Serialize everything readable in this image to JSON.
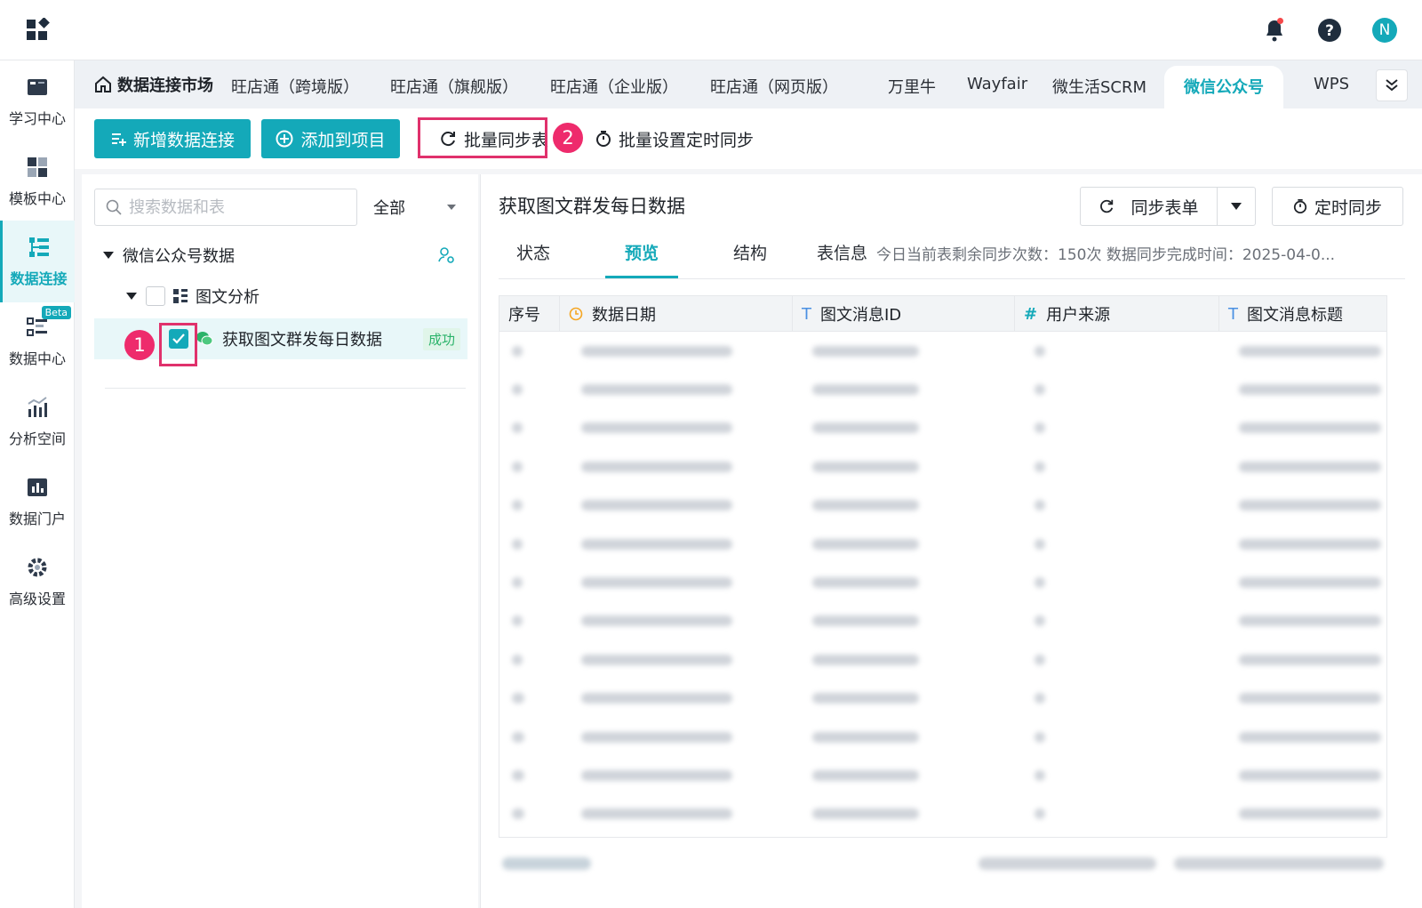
{
  "topbar": {
    "avatar_letter": "N"
  },
  "nav": {
    "items": [
      {
        "label": "学习中心",
        "icon": "book-icon"
      },
      {
        "label": "模板中心",
        "icon": "template-icon"
      },
      {
        "label": "数据连接",
        "icon": "data-connect-icon",
        "active": true
      },
      {
        "label": "数据中心",
        "icon": "data-center-icon",
        "badge": "Beta"
      },
      {
        "label": "分析空间",
        "icon": "analysis-icon"
      },
      {
        "label": "数据门户",
        "icon": "portal-icon"
      },
      {
        "label": "高级设置",
        "icon": "gear-icon"
      }
    ]
  },
  "tabs": {
    "home": "数据连接市场",
    "items": [
      "旺店通（跨境版）",
      "旺店通（旗舰版）",
      "旺店通（企业版）",
      "旺店通（网页版）",
      "万里牛",
      "Wayfair",
      "微生活SCRM",
      "微信公众号",
      "WPS"
    ],
    "active": "微信公众号"
  },
  "toolbar": {
    "add_connection": "新增数据连接",
    "add_to_project": "添加到项目",
    "batch_sync": "批量同步表",
    "batch_timer": "批量设置定时同步",
    "step1": "1",
    "step2": "2"
  },
  "leftpanel": {
    "search_placeholder": "搜索数据和表",
    "filter": "全部",
    "root": "微信公众号数据",
    "group": "图文分析",
    "table": "获取图文群发每日数据",
    "table_status": "成功"
  },
  "rightpanel": {
    "title": "获取图文群发每日数据",
    "sync_button": "同步表单",
    "timer_button": "定时同步",
    "subtabs": [
      "状态",
      "预览",
      "结构",
      "表信息"
    ],
    "active_subtab": "预览",
    "info": "今日当前表剩余同步次数：150次   数据同步完成时间：2025-04-0...",
    "columns": [
      {
        "label": "序号",
        "icon": ""
      },
      {
        "label": "数据日期",
        "icon": "clock-icon"
      },
      {
        "label": "图文消息ID",
        "icon": "text-type-icon"
      },
      {
        "label": "用户来源",
        "icon": "number-type-icon"
      },
      {
        "label": "图文消息标题",
        "icon": "text-type-icon"
      }
    ]
  },
  "colors": {
    "accent": "#14a9b9",
    "highlight": "#e0316c",
    "success": "#2bb36a"
  }
}
